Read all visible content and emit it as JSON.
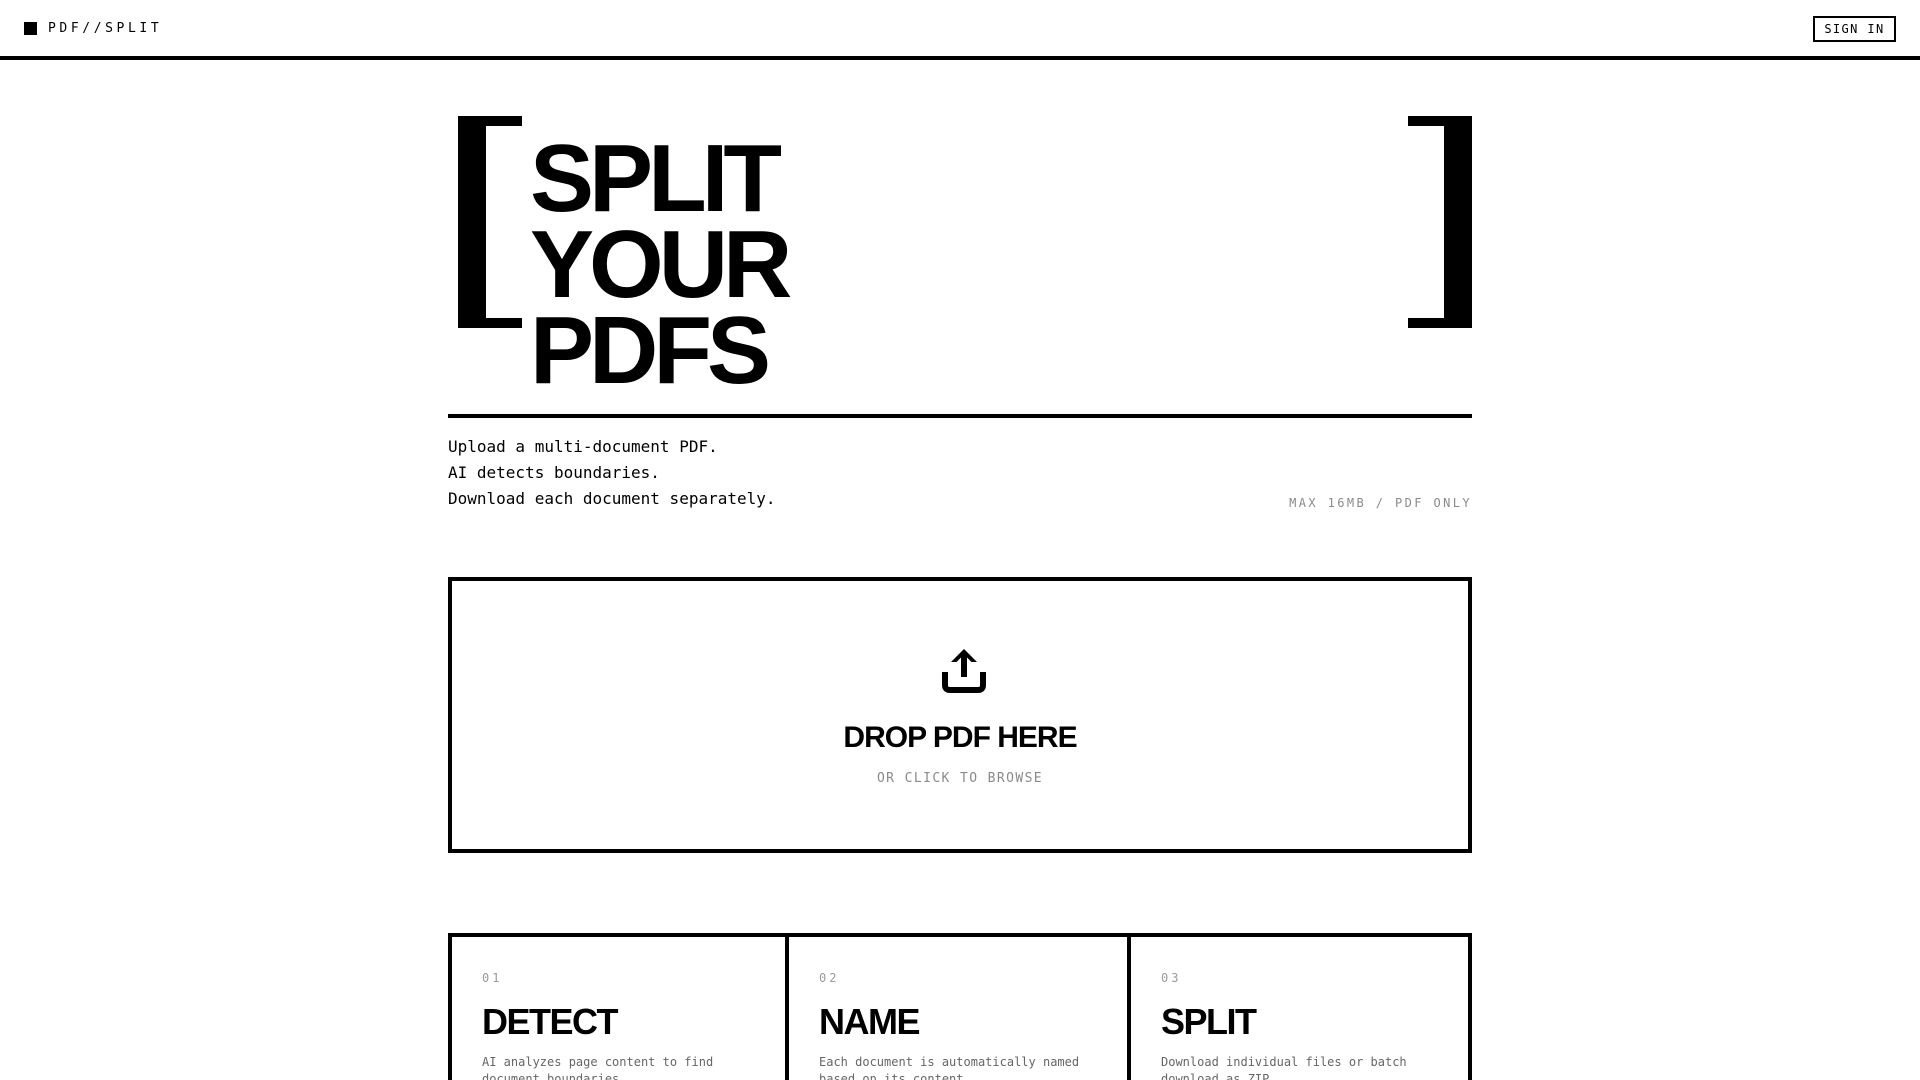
{
  "header": {
    "brand": "PDF//SPLIT",
    "sign_in_label": "SIGN IN"
  },
  "hero": {
    "title_lines": [
      "SPLIT",
      "YOUR",
      "PDFS"
    ],
    "tagline_lines": [
      "Upload a multi-document PDF.",
      "AI detects boundaries.",
      "Download each document separately."
    ],
    "limits": "MAX 16MB / PDF ONLY"
  },
  "dropzone": {
    "icon": "upload-icon",
    "title": "DROP PDF HERE",
    "subtitle": "OR CLICK TO BROWSE"
  },
  "features": [
    {
      "number": "01",
      "title": "DETECT",
      "description": "AI analyzes page content to find document boundaries"
    },
    {
      "number": "02",
      "title": "NAME",
      "description": "Each document is automatically named based on its content"
    },
    {
      "number": "03",
      "title": "SPLIT",
      "description": "Download individual files or batch download as ZIP"
    }
  ],
  "colors": {
    "background": "#ffffff",
    "ink": "#000000",
    "muted": "#8a8a8a"
  }
}
